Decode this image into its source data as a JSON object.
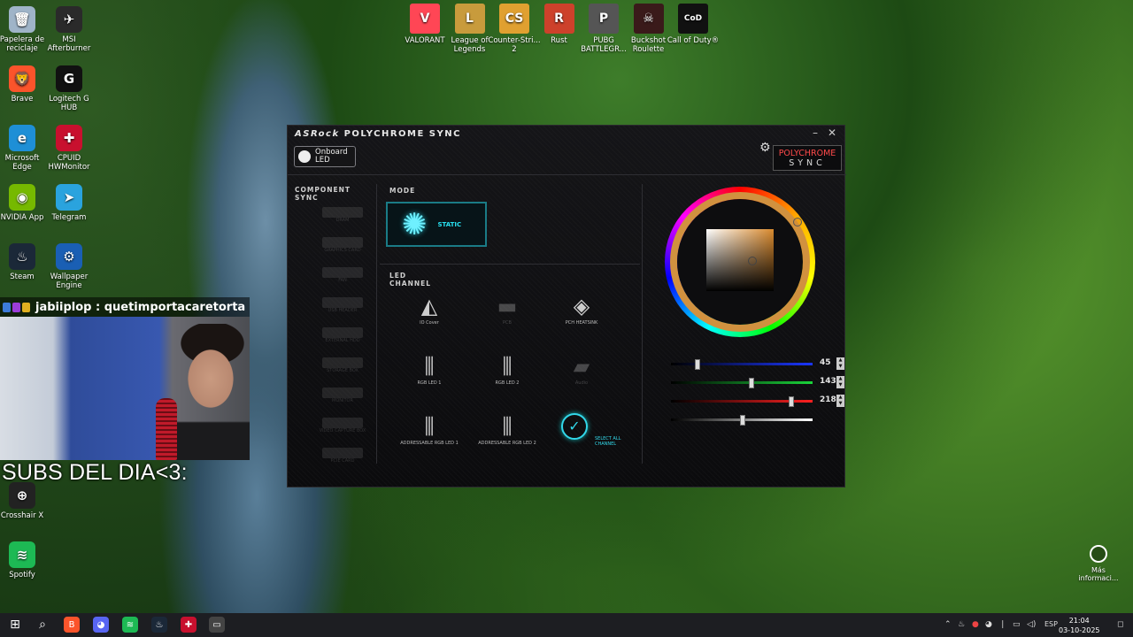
{
  "desktop": {
    "left_icons": [
      {
        "label": "Papelera de reciclaje",
        "icon": "recycle-bin-icon",
        "color": "#9fb4c8",
        "glyph": "🗑"
      },
      {
        "label": "MSI Afterburner",
        "icon": "msi-afterburner-icon",
        "color": "#2a2a2a",
        "glyph": "✈"
      },
      {
        "label": "Brave",
        "icon": "brave-icon",
        "color": "#fb542b",
        "glyph": "🦁"
      },
      {
        "label": "Logitech G HUB",
        "icon": "logitech-icon",
        "color": "#111111",
        "glyph": "G"
      },
      {
        "label": "Microsoft Edge",
        "icon": "edge-icon",
        "color": "#1e8fd6",
        "glyph": "e"
      },
      {
        "label": "CPUID HWMonitor",
        "icon": "hwmonitor-icon",
        "color": "#c8102e",
        "glyph": "✚"
      },
      {
        "label": "NVIDIA App",
        "icon": "nvidia-icon",
        "color": "#76b900",
        "glyph": "◉"
      },
      {
        "label": "Telegram",
        "icon": "telegram-icon",
        "color": "#2aa3de",
        "glyph": "➤"
      },
      {
        "label": "Steam",
        "icon": "steam-icon",
        "color": "#1b2838",
        "glyph": "♨"
      },
      {
        "label": "Wallpaper Engine",
        "icon": "wallpaper-engine-icon",
        "color": "#1a5fb4",
        "glyph": "⚙"
      },
      {
        "label": "Crosshair X",
        "icon": "crosshair-x-icon",
        "color": "#222222",
        "glyph": "⊕"
      },
      {
        "label": "Spotify",
        "icon": "spotify-icon",
        "color": "#1db954",
        "glyph": "≋"
      }
    ],
    "games": [
      {
        "label": "VALORANT",
        "icon": "valorant-icon",
        "color": "#ff4655",
        "glyph": "V"
      },
      {
        "label": "League of Legends",
        "icon": "league-icon",
        "color": "#c89b3c",
        "glyph": "L"
      },
      {
        "label": "Counter-Stri... 2",
        "icon": "cs2-icon",
        "color": "#e0a030",
        "glyph": "CS"
      },
      {
        "label": "Rust",
        "icon": "rust-icon",
        "color": "#cd412b",
        "glyph": "R"
      },
      {
        "label": "PUBG BATTLEGR...",
        "icon": "pubg-icon",
        "color": "#555555",
        "glyph": "P"
      },
      {
        "label": "Buckshot Roulette",
        "icon": "buckshot-icon",
        "color": "#3a1a1a",
        "glyph": "☠"
      },
      {
        "label": "Call of Duty®",
        "icon": "cod-icon",
        "color": "#111111",
        "glyph": "CoD"
      }
    ],
    "more_info": "Más informaci..."
  },
  "stream": {
    "chat_user": "jabiiplop",
    "chat_sep": " : ",
    "chat_msg": "quetimportacaretorta",
    "subs_text": "SUBS DEL DIA<3:"
  },
  "app": {
    "brand": "ASRock",
    "title": "POLYCHROME SYNC",
    "minimize": "–",
    "close": "✕",
    "onboard_line1": "Onboard",
    "onboard_line2": "LED",
    "logo_top": "POLYCHROME",
    "logo_bottom": "SYNC",
    "component_sync": "COMPONENT SYNC",
    "components": [
      "DRAM",
      "GRAPHICS CARD",
      "FAN",
      "USB HEADER",
      "EXTERNAL HDD",
      "STORAGE BOX",
      "MONITOR",
      "VIDEO CAPTURE BOX",
      "PCIE CARD"
    ],
    "mode_label": "MODE",
    "mode_value": "STATIC",
    "led_channel_label": "LED CHANNEL",
    "channels": [
      {
        "label": "IO Cover",
        "glyph": "◭",
        "dim": false
      },
      {
        "label": "PCB",
        "glyph": "▬",
        "dim": true
      },
      {
        "label": "PCH HEATSINK",
        "glyph": "◈",
        "dim": false
      },
      {
        "label": "RGB LED 1",
        "glyph": "⫼",
        "dim": false
      },
      {
        "label": "RGB LED 2",
        "glyph": "⫼",
        "dim": false
      },
      {
        "label": "Audio",
        "glyph": "▰",
        "dim": true
      },
      {
        "label": "ADDRESSABLE RGB LED 1",
        "glyph": "⫼",
        "dim": false
      },
      {
        "label": "ADDRESSABLE RGB LED 2",
        "glyph": "⫼",
        "dim": false
      }
    ],
    "select_all": "SELECT ALL CHANNEL",
    "color_hex": "#d98a2e",
    "sliders": [
      {
        "name": "blue",
        "value": "45",
        "level": 0.176,
        "color": "#1a36ff"
      },
      {
        "name": "green",
        "value": "143",
        "level": 0.561,
        "color": "#1ad43a"
      },
      {
        "name": "red",
        "value": "218",
        "level": 0.855,
        "color": "#ff2020"
      },
      {
        "name": "brightness",
        "value": "",
        "level": 0.5,
        "color": "#ffffff"
      }
    ]
  },
  "taskbar": {
    "apps": [
      {
        "icon": "start-icon",
        "glyph": "⊞",
        "color": "transparent"
      },
      {
        "icon": "search-icon",
        "glyph": "⌕",
        "color": "transparent"
      },
      {
        "icon": "brave-icon",
        "glyph": "B",
        "color": "#fb542b"
      },
      {
        "icon": "discord-icon",
        "glyph": "◕",
        "color": "#5865f2"
      },
      {
        "icon": "spotify-icon",
        "glyph": "≋",
        "color": "#1db954"
      },
      {
        "icon": "steam-icon",
        "glyph": "♨",
        "color": "#1b2838"
      },
      {
        "icon": "hwmonitor-icon",
        "glyph": "✚",
        "color": "#c8102e"
      },
      {
        "icon": "polychrome-icon",
        "glyph": "▭",
        "color": "#444444"
      }
    ],
    "lang": "ESP",
    "time": "21:04",
    "date": "03-10-2025"
  }
}
